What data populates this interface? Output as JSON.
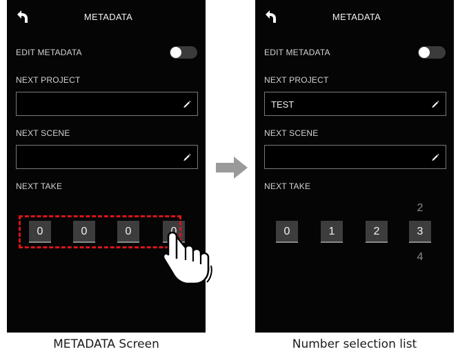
{
  "left_screen": {
    "title": "METADATA",
    "edit_metadata_label": "EDIT METADATA",
    "next_project_label": "NEXT PROJECT",
    "next_project_value": "",
    "next_scene_label": "NEXT SCENE",
    "next_scene_value": "",
    "next_take_label": "NEXT TAKE",
    "take_digits": [
      "0",
      "0",
      "0",
      "0"
    ]
  },
  "right_screen": {
    "title": "METADATA",
    "edit_metadata_label": "EDIT METADATA",
    "next_project_label": "NEXT PROJECT",
    "next_project_value": "TEST",
    "next_scene_label": "NEXT SCENE",
    "next_scene_value": "",
    "next_take_label": "NEXT TAKE",
    "take_digits": [
      "0",
      "1",
      "2",
      "3"
    ],
    "selection_above": "2",
    "selection_below": "4"
  },
  "captions": {
    "left": "METADATA Screen",
    "right": "Number selection list"
  },
  "icons": [
    "back-arrow-icon",
    "pencil-icon",
    "toggle-switch",
    "pointing-hand-icon",
    "right-arrow-icon"
  ],
  "colors": {
    "screen_background": "#050505",
    "digit_box": "#3d3d3d",
    "highlight": "#d9141b",
    "arrow": "#9a9a9a"
  },
  "edit_metadata_enabled": false
}
